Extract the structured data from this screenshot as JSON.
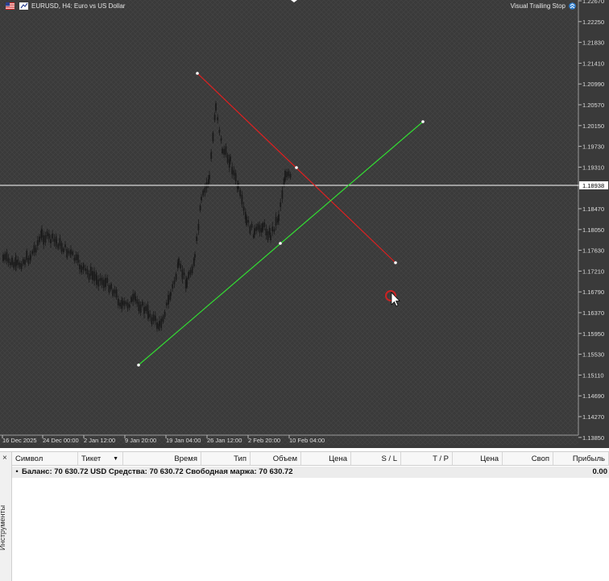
{
  "chart": {
    "symbol_title": "EURUSD, H4:  Euro vs US Dollar",
    "ea_name": "Visual Trailing Stop",
    "price_levels": [
      "1.22670",
      "1.22250",
      "1.21830",
      "1.21410",
      "1.20990",
      "1.20570",
      "1.20150",
      "1.19730",
      "1.19310",
      "1.18938",
      "1.18470",
      "1.18050",
      "1.17630",
      "1.17210",
      "1.16790",
      "1.16370",
      "1.15950",
      "1.15530",
      "1.15110",
      "1.14690",
      "1.14270",
      "1.13850"
    ],
    "current_price": "1.18938",
    "time_labels": [
      "16 Dec 2025",
      "24 Dec 00:00",
      "2 Jan 12:00",
      "9 Jan 20:00",
      "19 Jan 04:00",
      "26 Jan 12:00",
      "2 Feb 20:00",
      "10 Feb 04:00"
    ],
    "colors": {
      "background": "#3a3a3a",
      "candle": "#1a1a1a",
      "resistance_line": "#e02020",
      "support_line": "#33dd33",
      "price_line": "#ffffff"
    },
    "trendlines": [
      {
        "name": "resistance",
        "color": "#e02020"
      },
      {
        "name": "support",
        "color": "#33dd33"
      }
    ]
  },
  "toolbox": {
    "close_icon": "×",
    "panel_title": "Инструменты",
    "columns": [
      "Символ",
      "Тикет",
      "Время",
      "Тип",
      "Объем",
      "Цена",
      "S / L",
      "T / P",
      "Цена",
      "Своп",
      "Прибыль"
    ],
    "balance_row": "Баланс: 70 630.72 USD  Средства: 70 630.72  Свободная маржа: 70 630.72",
    "balance_value": "0.00"
  }
}
